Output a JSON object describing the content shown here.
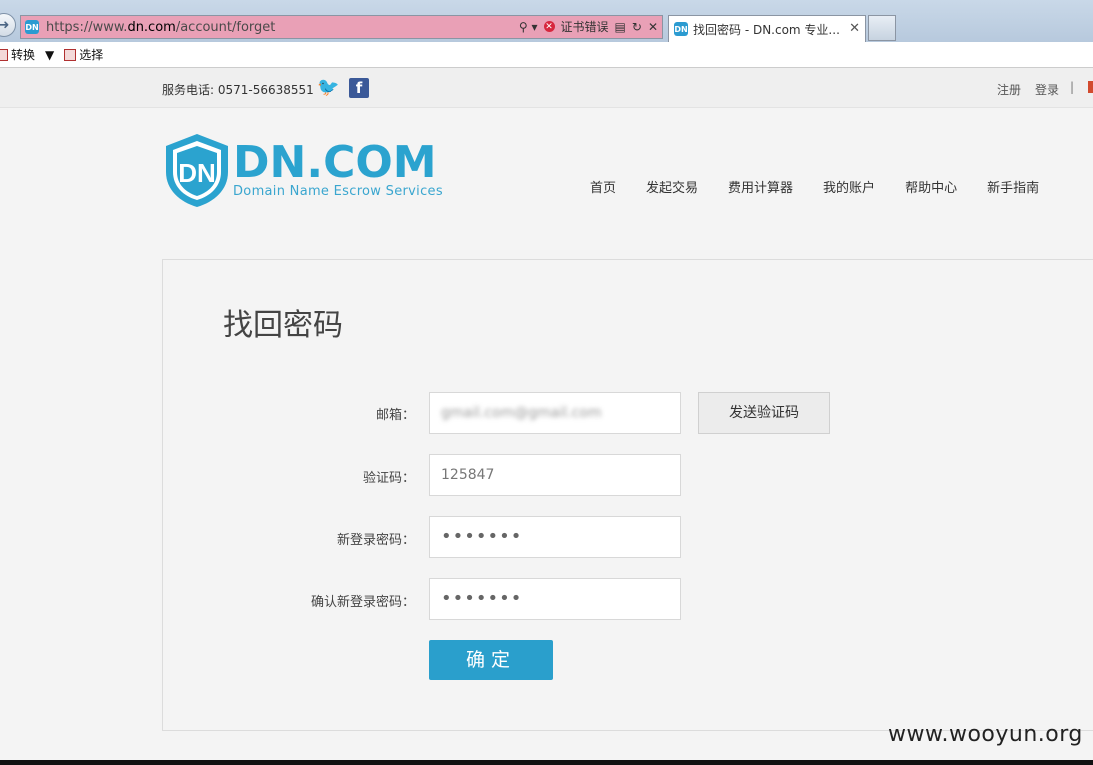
{
  "browser": {
    "url_prefix": "https://www.",
    "url_domain": "dn.com",
    "url_path": "/account/forget",
    "cert_error": "证书错误",
    "tab_title": "找回密码 - DN.com 专业...",
    "toolbar": {
      "convert": "转换",
      "select": "选择"
    }
  },
  "topbar": {
    "phone": "服务电话: 0571-56638551",
    "register": "注册",
    "login": "登录",
    "separator": "|"
  },
  "logo": {
    "name": "DN.COM",
    "tagline": "Domain Name Escrow Services"
  },
  "nav": [
    "首页",
    "发起交易",
    "费用计算器",
    "我的账户",
    "帮助中心",
    "新手指南"
  ],
  "form": {
    "title": "找回密码",
    "email_label": "邮箱：",
    "email_value": "gmail.com@gmail.com",
    "send_code": "发送验证码",
    "code_label": "验证码：",
    "code_value": "125847",
    "new_pw_label": "新登录密码：",
    "new_pw_value": "•••••••",
    "confirm_pw_label": "确认新登录密码：",
    "confirm_pw_value": "•••••••",
    "submit": "确定"
  },
  "watermark": "www.wooyun.org",
  "colors": {
    "brand": "#2ba3cf",
    "button": "#2a9fcc"
  }
}
